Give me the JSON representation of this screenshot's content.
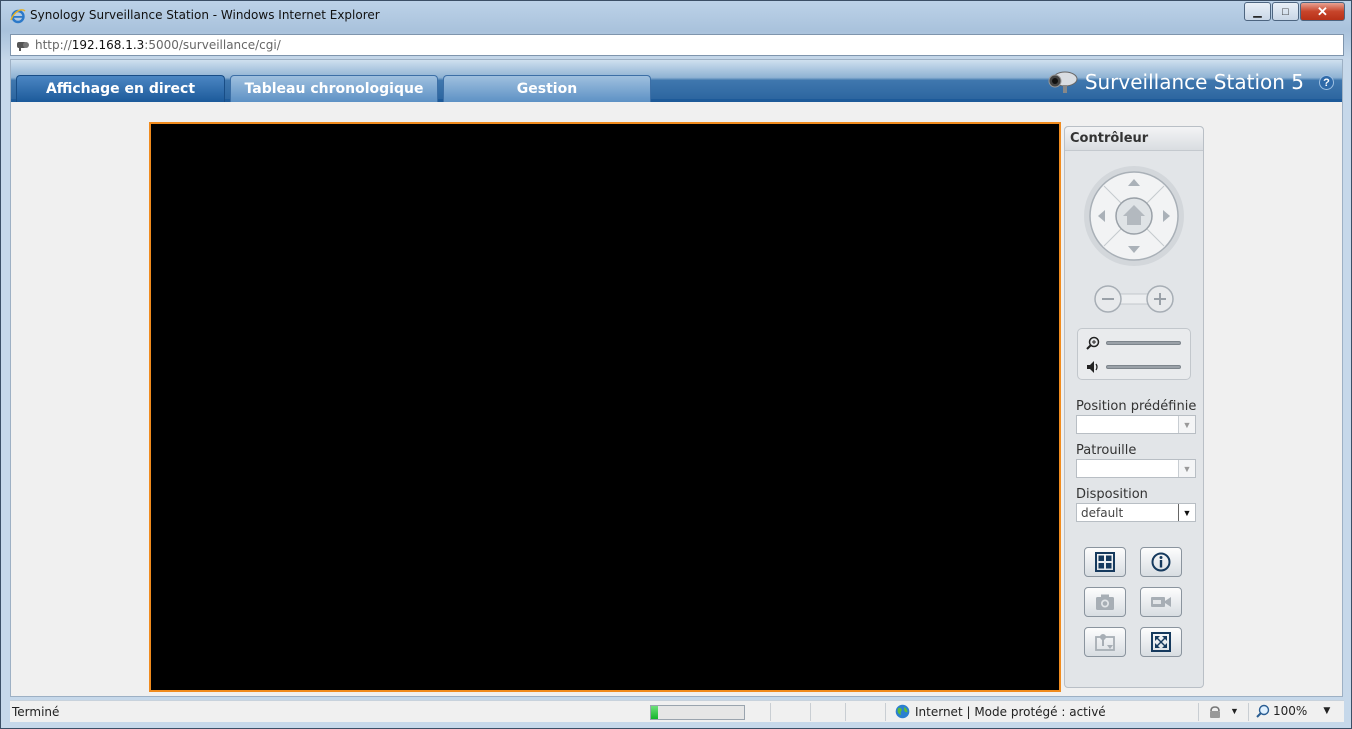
{
  "window": {
    "title": "Synology Surveillance Station - Windows Internet Explorer",
    "minimize": "▁",
    "maximize": "□",
    "close": "✕"
  },
  "address": {
    "prefix": "http://",
    "host": "192.168.1.3",
    "rest": ":5000/surveillance/cgi/"
  },
  "tabs": [
    {
      "label": "Affichage en direct",
      "active": true
    },
    {
      "label": "Tableau chronologique",
      "active": false
    },
    {
      "label": "Gestion",
      "active": false
    }
  ],
  "brand": {
    "title": "Surveillance Station 5",
    "help": "?"
  },
  "controller": {
    "title": "Contrôleur",
    "preset_label": "Position prédéfinie",
    "preset_value": "",
    "patrol_label": "Patrouille",
    "patrol_value": "",
    "layout_label": "Disposition",
    "layout_value": "default",
    "icons": {
      "joystick": "ptz-joystick-icon",
      "home": "home-icon",
      "zoom_out": "minus-icon",
      "zoom_in": "plus-icon",
      "zoom_slider": "magnifier-icon",
      "volume_slider": "speaker-icon",
      "layout": "grid-layout-icon",
      "info": "info-icon",
      "snapshot": "camera-icon",
      "record": "video-camera-icon",
      "map": "map-icon",
      "fullscreen": "fullscreen-icon"
    }
  },
  "status": {
    "text": "Terminé",
    "progress": 0.07,
    "zone": "Internet | Mode protégé : activé",
    "zoom": "100%"
  },
  "colors": {
    "accent": "#1d5a99",
    "video_border": "#f08b1e",
    "progress_fill": "#13b52a"
  }
}
